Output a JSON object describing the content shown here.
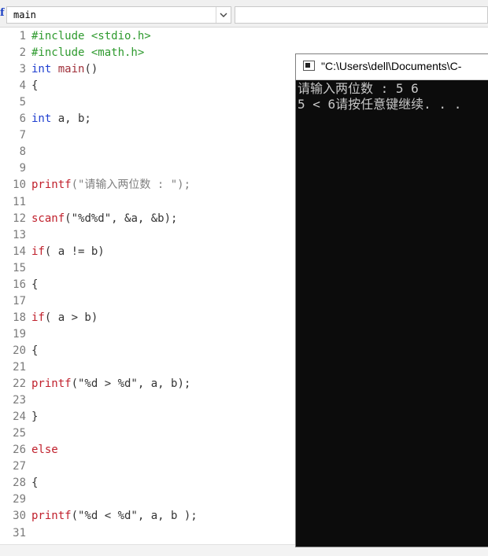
{
  "toolbar": {
    "function_icon": "f",
    "function_select_value": "main"
  },
  "editor": {
    "lines": [
      {
        "n": "1",
        "tokens": [
          {
            "t": "#include <stdio.h>",
            "c": "k-inc"
          }
        ]
      },
      {
        "n": "2",
        "tokens": [
          {
            "t": "#include <math.h>",
            "c": "k-inc"
          }
        ]
      },
      {
        "n": "3",
        "tokens": [
          {
            "t": "int ",
            "c": "k-blue"
          },
          {
            "t": "main",
            "c": "k-fn"
          },
          {
            "t": "()",
            "c": "k-dark"
          }
        ]
      },
      {
        "n": "4",
        "tokens": [
          {
            "t": "{",
            "c": "k-dark"
          }
        ]
      },
      {
        "n": "5",
        "tokens": []
      },
      {
        "n": "6",
        "tokens": [
          {
            "t": "int ",
            "c": "k-blue"
          },
          {
            "t": "a, b;",
            "c": "k-dark"
          }
        ]
      },
      {
        "n": "7",
        "tokens": []
      },
      {
        "n": "8",
        "tokens": []
      },
      {
        "n": "9",
        "tokens": []
      },
      {
        "n": "10",
        "tokens": [
          {
            "t": "printf",
            "c": "k-red"
          },
          {
            "t": "(\"请输入两位数 : \");",
            "c": "k-gray"
          }
        ]
      },
      {
        "n": "11",
        "tokens": []
      },
      {
        "n": "12",
        "tokens": [
          {
            "t": "scanf",
            "c": "k-red"
          },
          {
            "t": "(\"%d%d\", &a, &b);",
            "c": "k-dark"
          }
        ]
      },
      {
        "n": "13",
        "tokens": []
      },
      {
        "n": "14",
        "tokens": [
          {
            "t": "if",
            "c": "k-red"
          },
          {
            "t": "( a != b)",
            "c": "k-dark"
          }
        ]
      },
      {
        "n": "15",
        "tokens": []
      },
      {
        "n": "16",
        "tokens": [
          {
            "t": "{",
            "c": "k-dark"
          }
        ]
      },
      {
        "n": "17",
        "tokens": []
      },
      {
        "n": "18",
        "tokens": [
          {
            "t": "if",
            "c": "k-red"
          },
          {
            "t": "( a > b)",
            "c": "k-dark"
          }
        ]
      },
      {
        "n": "19",
        "tokens": []
      },
      {
        "n": "20",
        "tokens": [
          {
            "t": "{",
            "c": "k-dark"
          }
        ]
      },
      {
        "n": "21",
        "tokens": []
      },
      {
        "n": "22",
        "tokens": [
          {
            "t": "printf",
            "c": "k-red"
          },
          {
            "t": "(\"%d > %d\", a, b);",
            "c": "k-dark"
          }
        ]
      },
      {
        "n": "23",
        "tokens": []
      },
      {
        "n": "24",
        "tokens": [
          {
            "t": "}",
            "c": "k-dark"
          }
        ]
      },
      {
        "n": "25",
        "tokens": []
      },
      {
        "n": "26",
        "tokens": [
          {
            "t": "else",
            "c": "k-red"
          }
        ]
      },
      {
        "n": "27",
        "tokens": []
      },
      {
        "n": "28",
        "tokens": [
          {
            "t": "{",
            "c": "k-dark"
          }
        ]
      },
      {
        "n": "29",
        "tokens": []
      },
      {
        "n": "30",
        "tokens": [
          {
            "t": "printf",
            "c": "k-red"
          },
          {
            "t": "(\"%d < %d\", a, b );",
            "c": "k-dark"
          }
        ]
      },
      {
        "n": "31",
        "tokens": []
      }
    ]
  },
  "console": {
    "title": "\"C:\\Users\\dell\\Documents\\C-",
    "output_lines": [
      "请输入两位数 : 5 6",
      "5 < 6请按任意键继续. . ."
    ]
  }
}
